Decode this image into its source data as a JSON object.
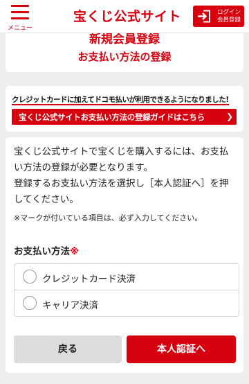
{
  "header": {
    "menu_label": "メニュー",
    "logo_text": "宝くじ公式サイト",
    "login_line1": "ログイン",
    "login_line2": "会員登録"
  },
  "title": {
    "line1": "新規会員登録",
    "line2": "お支払い方法の登録"
  },
  "banner": {
    "notice": "クレジットカードに加えてドコモ払いが利用できるようになりました!",
    "link_label": "宝くじ公式サイトお支払い方法の登録ガイドはこちら",
    "link_arrow": "❯"
  },
  "main": {
    "intro_1": "宝くじ公式サイトで宝くじを購入するには、お支払い方法の登録が必要となります。",
    "intro_2": "登録するお支払い方法を選択し［本人認証へ］を押してください。",
    "note": "※マークが付いている項目は、必ず入力してください。",
    "field_label": "お支払い方法",
    "required_mark": "※",
    "options": [
      {
        "label": "クレジットカード決済",
        "selected": false
      },
      {
        "label": "キャリア決済",
        "selected": false
      }
    ],
    "back_label": "戻る",
    "next_label": "本人認証へ"
  },
  "colors": {
    "accent": "#d7000f",
    "background": "#eeeeee"
  },
  "icons": {
    "menu": "hamburger-icon",
    "login": "login-enter-icon",
    "arrow": "chevron-right-icon"
  }
}
